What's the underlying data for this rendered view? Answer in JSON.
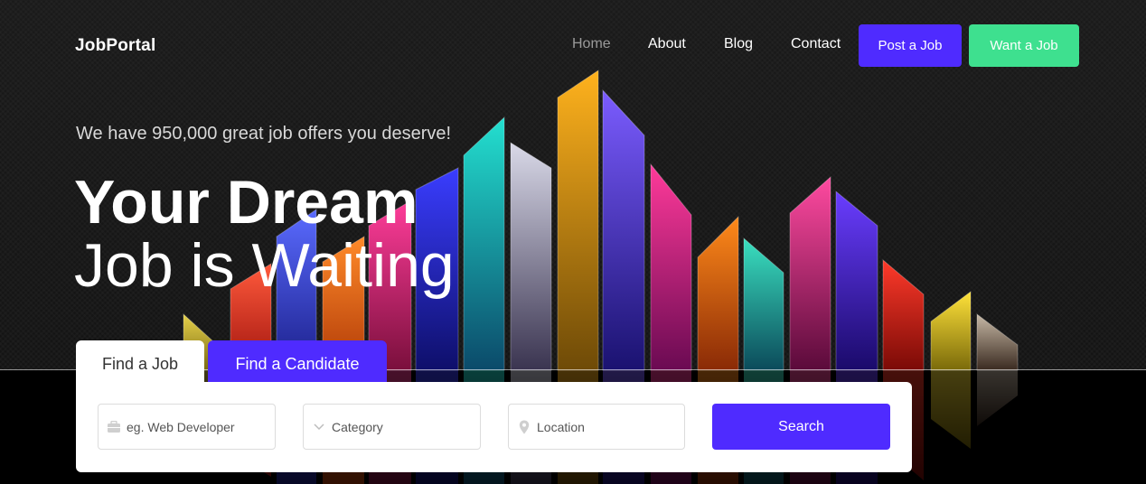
{
  "header": {
    "logo": "JobPortal",
    "nav": [
      "Home",
      "About",
      "Blog",
      "Contact"
    ],
    "post_job": "Post a Job",
    "want_job": "Want a Job"
  },
  "hero": {
    "tagline": "We have 950,000 great job offers you deserve!",
    "title_line1": "Your Dream",
    "title_line2": "Job is Waiting"
  },
  "search": {
    "tabs": [
      "Find a Job",
      "Find a Candidate"
    ],
    "keyword_placeholder": "eg. Web Developer",
    "category_label": "Category",
    "location_placeholder": "Location",
    "submit": "Search"
  },
  "colors": {
    "primary": "#4f2bff",
    "secondary": "#3ee08f"
  },
  "icons": [
    "briefcase-icon",
    "chevron-down-icon",
    "map-pin-icon"
  ]
}
